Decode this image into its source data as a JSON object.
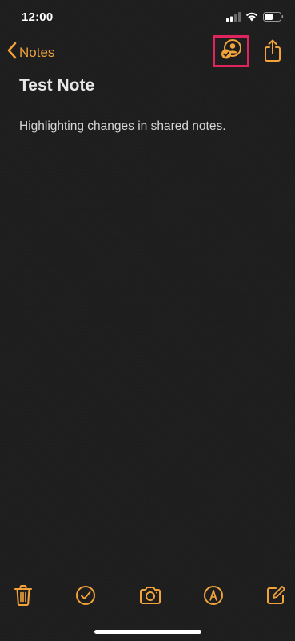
{
  "status_bar": {
    "time": "12:00"
  },
  "nav": {
    "back_label": "Notes",
    "back_icon": "chevron-left-icon",
    "collaborate_icon": "person-badge-icon",
    "share_icon": "share-icon"
  },
  "note": {
    "title": "Test Note",
    "body": "Highlighting changes in shared notes."
  },
  "toolbar": {
    "items": [
      "trash-icon",
      "checklist-icon",
      "camera-icon",
      "markup-icon",
      "compose-icon"
    ]
  },
  "colors": {
    "accent": "#f2a33a",
    "highlight_box": "#e0245e",
    "background": "#1e1e1e",
    "text": "#e6e6e6"
  }
}
